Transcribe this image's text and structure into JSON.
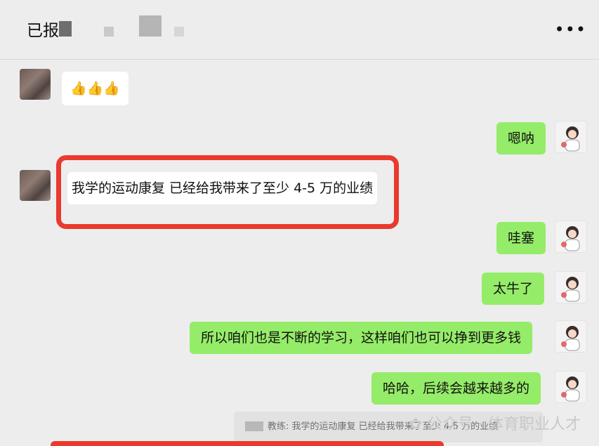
{
  "header": {
    "title": "已报"
  },
  "messages": [
    {
      "side": "other",
      "text": "👍👍👍"
    },
    {
      "side": "me",
      "text": "嗯呐"
    },
    {
      "side": "other",
      "text": "我学的运动康复 已经给我带来了至少 4-5 万的业绩"
    },
    {
      "side": "me",
      "text": "哇塞"
    },
    {
      "side": "me",
      "text": "太牛了"
    },
    {
      "side": "me",
      "text": "所以咱们也是不断的学习，这样咱们也可以挣到更多钱"
    },
    {
      "side": "me",
      "text": "哈哈，后续会越来越多的"
    }
  ],
  "quote": {
    "text": "教练: 我学的运动康复 已经给我带来了至少 4-5 万的业绩"
  },
  "watermark": "公众号 · 体育职业人才",
  "colors": {
    "me_bubble": "#95ec69",
    "other_bubble": "#ffffff",
    "highlight": "#ea3a2e",
    "background": "#ededed"
  }
}
